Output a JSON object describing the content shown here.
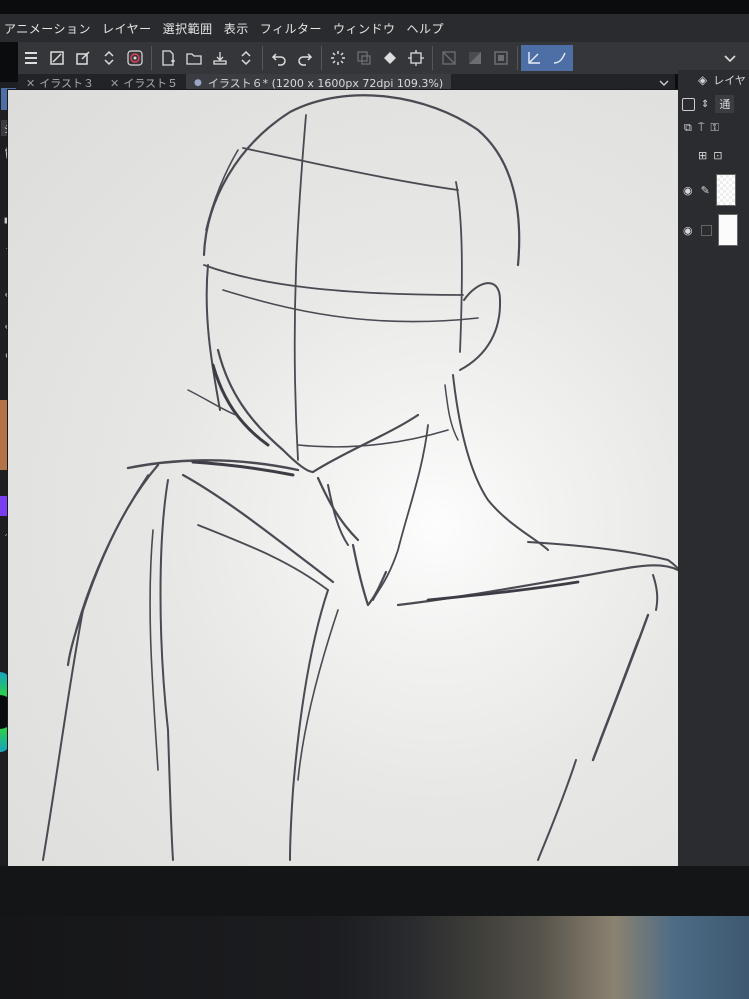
{
  "menu": {
    "items": [
      "アニメーション",
      "レイヤー",
      "選択範囲",
      "表示",
      "フィルター",
      "ウィンドウ",
      "ヘルプ"
    ]
  },
  "toolbar": {
    "icons": [
      "menu-icon",
      "square-diagonal-icon",
      "clip-icon",
      "up-down-arrows-icon",
      "spiral-icon",
      "new-document-icon",
      "open-folder-icon",
      "save-icon",
      "up-down-arrows-icon",
      "undo-icon",
      "redo-icon",
      "loading-icon",
      "transform-icon",
      "fill-icon",
      "crop-icon",
      "snap-icon",
      "gradient-icon",
      "frame-icon",
      "pen-active-icon",
      "curve-active-icon",
      "chevron-down-icon"
    ]
  },
  "tabs": [
    {
      "label": "イラスト３",
      "active": false
    },
    {
      "label": "イラスト５",
      "active": false
    },
    {
      "label": "イラスト６* (1200 x 1600px 72dpi 109.3%)",
      "active": true
    }
  ],
  "right_panel": {
    "title": "レイヤ",
    "blend_mode": "通"
  },
  "colors": {
    "accent": "#4e6fa6",
    "swatch_main": "#b27349",
    "swatch_sub": "#7a3cf0",
    "wheel_green": "#2ecf4a",
    "stroke": "#4a4a52"
  }
}
